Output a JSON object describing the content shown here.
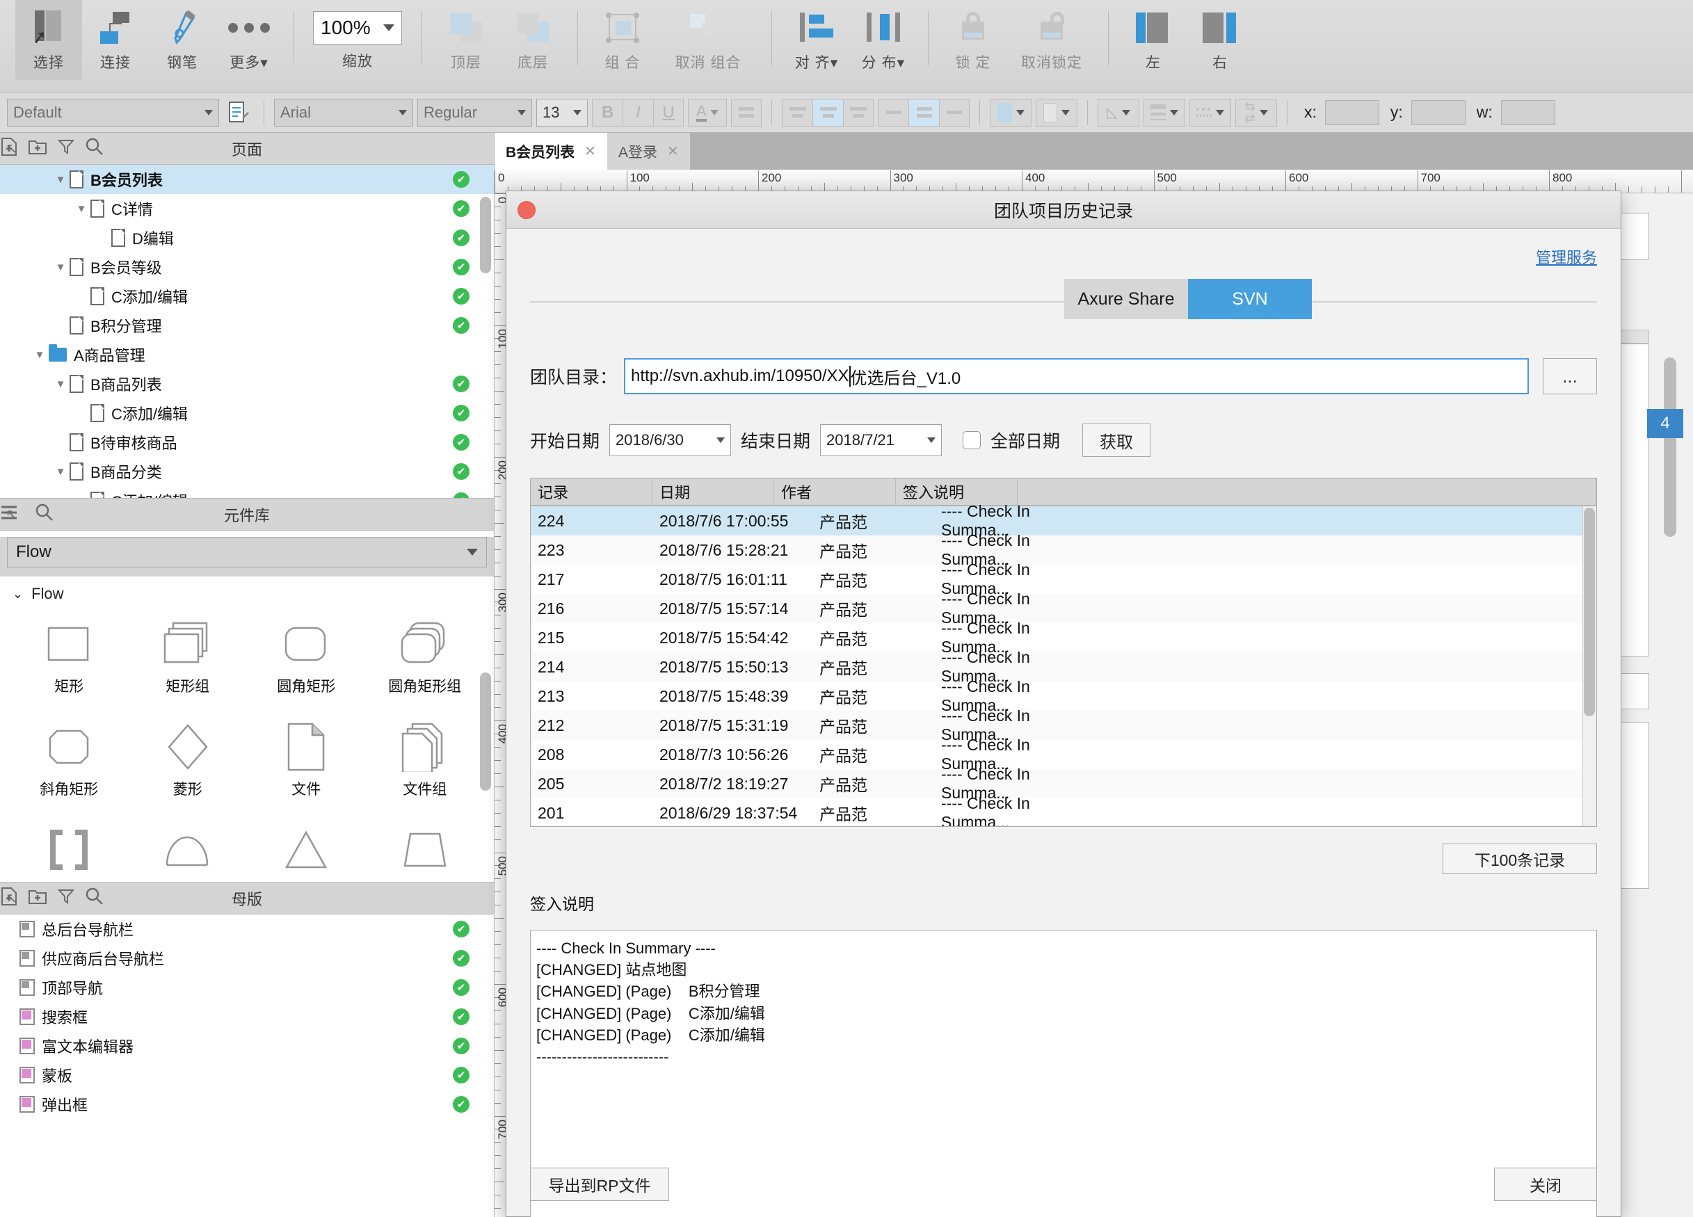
{
  "toolbar": {
    "items": [
      {
        "label": "选择",
        "icon": "select-icon",
        "selected": true
      },
      {
        "label": "连接",
        "icon": "connect-icon",
        "selected": false
      },
      {
        "label": "钢笔",
        "icon": "pen-icon",
        "selected": false
      },
      {
        "label": "更多▾",
        "icon": "more-icon",
        "selected": false
      }
    ],
    "zoom_value": "100%",
    "zoom_label": "缩放",
    "order": [
      {
        "label": "顶层",
        "icon": "bring-front-icon"
      },
      {
        "label": "底层",
        "icon": "send-back-icon"
      }
    ],
    "group": [
      {
        "label": "组 合",
        "icon": "group-icon"
      },
      {
        "label": "取消 组合",
        "icon": "ungroup-icon"
      }
    ],
    "arrange": [
      {
        "label": "对 齐▾",
        "icon": "align-icon"
      },
      {
        "label": "分 布▾",
        "icon": "distribute-icon"
      }
    ],
    "lock": [
      {
        "label": "锁 定",
        "icon": "lock-icon"
      },
      {
        "label": "取消锁定",
        "icon": "unlock-icon"
      }
    ],
    "sides": [
      {
        "label": "左",
        "icon": "left-panel-icon"
      },
      {
        "label": "右",
        "icon": "right-panel-icon"
      }
    ]
  },
  "formatbar": {
    "style_value": "Default",
    "font_value": "Arial",
    "weight_value": "Regular",
    "size_value": "13",
    "bold": "B",
    "italic": "I",
    "underline": "U",
    "x_label": "x:",
    "y_label": "y:",
    "w_label": "w:",
    "x_value": "",
    "y_value": "",
    "w_value": ""
  },
  "pages_panel": {
    "title": "页面",
    "icons": [
      "collapse-icon",
      "add-page-icon",
      "add-folder-icon",
      "filter-icon",
      "search-icon"
    ],
    "tree": [
      {
        "label": "B会员列表",
        "indent": 2,
        "twisty": "▼",
        "icon": "page",
        "check": true,
        "selected": true,
        "bold": true
      },
      {
        "label": "C详情",
        "indent": 3,
        "twisty": "▼",
        "icon": "page",
        "check": true
      },
      {
        "label": "D编辑",
        "indent": 4,
        "twisty": "",
        "icon": "page",
        "check": true
      },
      {
        "label": "B会员等级",
        "indent": 2,
        "twisty": "▼",
        "icon": "page",
        "check": true
      },
      {
        "label": "C添加/编辑",
        "indent": 3,
        "twisty": "",
        "icon": "page",
        "check": true
      },
      {
        "label": "B积分管理",
        "indent": 2,
        "twisty": "",
        "icon": "page",
        "check": true
      },
      {
        "label": "A商品管理",
        "indent": 1,
        "twisty": "▼",
        "icon": "folder",
        "check": false
      },
      {
        "label": "B商品列表",
        "indent": 2,
        "twisty": "▼",
        "icon": "page",
        "check": true
      },
      {
        "label": "C添加/编辑",
        "indent": 3,
        "twisty": "",
        "icon": "page",
        "check": true
      },
      {
        "label": "B待审核商品",
        "indent": 2,
        "twisty": "",
        "icon": "page",
        "check": true
      },
      {
        "label": "B商品分类",
        "indent": 2,
        "twisty": "▼",
        "icon": "page",
        "check": true
      },
      {
        "label": "C添加/编辑",
        "indent": 3,
        "twisty": "",
        "icon": "page",
        "check": true
      }
    ]
  },
  "library_panel": {
    "title": "元件库",
    "icons": [
      "collapse-icon",
      "menu-icon",
      "search-icon"
    ],
    "selected_library": "Flow",
    "group_label": "Flow",
    "widgets": [
      {
        "name": "矩形",
        "shape": "rect"
      },
      {
        "name": "矩形组",
        "shape": "rect-stack"
      },
      {
        "name": "圆角矩形",
        "shape": "round-rect"
      },
      {
        "name": "圆角矩形组",
        "shape": "round-rect-stack"
      },
      {
        "name": "斜角矩形",
        "shape": "octagon"
      },
      {
        "name": "菱形",
        "shape": "diamond"
      },
      {
        "name": "文件",
        "shape": "file"
      },
      {
        "name": "文件组",
        "shape": "file-stack"
      },
      {
        "name": "",
        "shape": "brackets"
      },
      {
        "name": "",
        "shape": "半圆"
      },
      {
        "name": "",
        "shape": "triangle"
      },
      {
        "name": "",
        "shape": "trapezoid"
      }
    ]
  },
  "master_panel": {
    "title": "母版",
    "icons": [
      "collapse-icon",
      "add-master-icon",
      "add-folder-icon",
      "filter-icon",
      "search-icon"
    ],
    "items": [
      {
        "label": "总后台导航栏",
        "icon": "master-gray",
        "check": true
      },
      {
        "label": "供应商后台导航栏",
        "icon": "master-gray",
        "check": true
      },
      {
        "label": "顶部导航",
        "icon": "master-gray",
        "check": true
      },
      {
        "label": "搜索框",
        "icon": "master-pink",
        "check": true
      },
      {
        "label": "富文本编辑器",
        "icon": "master-pink",
        "check": true
      },
      {
        "label": "蒙板",
        "icon": "master-pink",
        "check": true
      },
      {
        "label": "弹出框",
        "icon": "master-pink",
        "check": true
      }
    ]
  },
  "tabs": [
    {
      "label": "B会员列表",
      "active": true,
      "close": "✕"
    },
    {
      "label": "A登录",
      "active": false,
      "close": "✕"
    }
  ],
  "ruler": {
    "h_labels": [
      "0",
      "100",
      "200",
      "300",
      "400",
      "500",
      "600",
      "700",
      "800"
    ],
    "v_labels": [
      "0",
      "100",
      "200",
      "300",
      "400",
      "500",
      "600",
      "700"
    ]
  },
  "canvas_widget_label": "4",
  "dialog": {
    "title": "团队项目历史记录",
    "manage_link": "管理服务",
    "segments": [
      {
        "label": "Axure Share",
        "active": false
      },
      {
        "label": "SVN",
        "active": true
      }
    ],
    "dir_label": "团队目录：",
    "dir_value": "http://svn.axhub.im/10950/XX优选后台_V1.0",
    "dir_value_before_cursor": "http://svn.axhub.im/10950/XX",
    "dir_value_after_cursor": "优选后台_V1.0",
    "browse_button": "...",
    "start_label": "开始日期",
    "start_value": "2018/6/30",
    "end_label": "结束日期",
    "end_value": "2018/7/21",
    "all_dates_label": "全部日期",
    "all_dates_checked": false,
    "fetch_button": "获取",
    "table": {
      "columns": [
        "记录",
        "日期",
        "作者",
        "签入说明",
        ""
      ],
      "rows": [
        {
          "id": "224",
          "date": "2018/7/6 17:00:55",
          "author": "产品范",
          "summary": "---- Check In Summa...",
          "selected": true
        },
        {
          "id": "223",
          "date": "2018/7/6 15:28:21",
          "author": "产品范",
          "summary": "---- Check In Summa...",
          "selected": false
        },
        {
          "id": "217",
          "date": "2018/7/5 16:01:11",
          "author": "产品范",
          "summary": "---- Check In Summa...",
          "selected": false
        },
        {
          "id": "216",
          "date": "2018/7/5 15:57:14",
          "author": "产品范",
          "summary": "---- Check In Summa...",
          "selected": false
        },
        {
          "id": "215",
          "date": "2018/7/5 15:54:42",
          "author": "产品范",
          "summary": "---- Check In Summa...",
          "selected": false
        },
        {
          "id": "214",
          "date": "2018/7/5 15:50:13",
          "author": "产品范",
          "summary": "---- Check In Summa...",
          "selected": false
        },
        {
          "id": "213",
          "date": "2018/7/5 15:48:39",
          "author": "产品范",
          "summary": "---- Check In Summa...",
          "selected": false
        },
        {
          "id": "212",
          "date": "2018/7/5 15:31:19",
          "author": "产品范",
          "summary": "---- Check In Summa...",
          "selected": false
        },
        {
          "id": "208",
          "date": "2018/7/3 10:56:26",
          "author": "产品范",
          "summary": "---- Check In Summa...",
          "selected": false
        },
        {
          "id": "205",
          "date": "2018/7/2 18:19:27",
          "author": "产品范",
          "summary": "---- Check In Summa...",
          "selected": false
        },
        {
          "id": "201",
          "date": "2018/6/29 18:37:54",
          "author": "产品范",
          "summary": "---- Check In Summa...",
          "selected": false
        }
      ]
    },
    "next_button": "下100条记录",
    "summary_label": "签入说明",
    "summary_text": "---- Check In Summary ----\n[CHANGED] 站点地图\n[CHANGED] (Page)    B积分管理\n[CHANGED] (Page)    C添加/编辑\n[CHANGED] (Page)    C添加/编辑\n--------------------------",
    "export_button": "导出到RP文件",
    "close_button": "关闭"
  },
  "colors": {
    "accent": "#3a95d4",
    "seg_active": "#46a0dd",
    "selection": "#cbe5f6",
    "check_green": "#3cbd54",
    "link": "#2a6fc0",
    "master_pink": "#dd8bd2"
  }
}
